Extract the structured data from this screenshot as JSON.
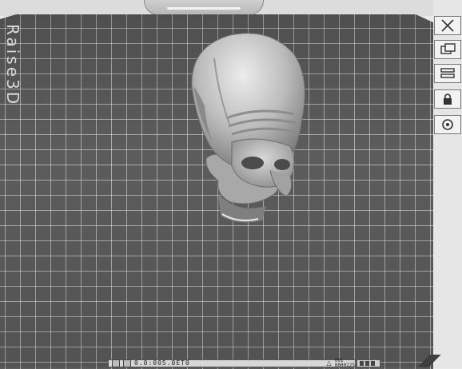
{
  "plate": {
    "brand_text": "Raise3D"
  },
  "sidebar": {
    "tools": [
      {
        "name": "close-icon"
      },
      {
        "name": "view-icon"
      },
      {
        "name": "layers-icon"
      },
      {
        "name": "lock-icon"
      },
      {
        "name": "settings-icon"
      }
    ]
  },
  "statusbar": {
    "coordinates": "0.0:005.0ET0",
    "warning_line1": "001",
    "warning_line2": "0000225"
  },
  "colors": {
    "plate": "#5c5c5c",
    "grid": "#d0d0d0",
    "model": "#c8c8c8",
    "frame": "#e6e6e6"
  }
}
